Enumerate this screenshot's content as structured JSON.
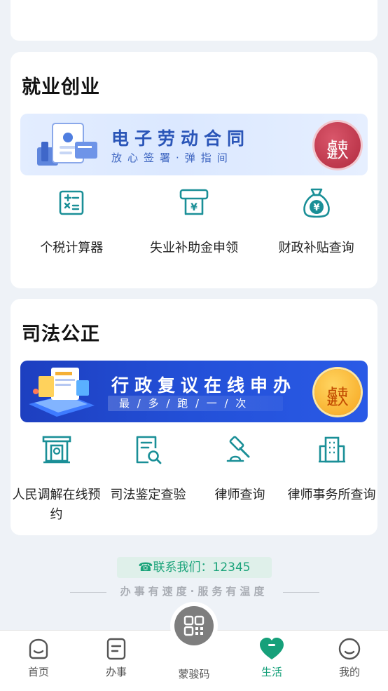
{
  "employment": {
    "title": "就业创业",
    "banner": {
      "title": "电子劳动合同",
      "subtitle": "放心签署·弹指间",
      "button": [
        "点击",
        "进入"
      ]
    },
    "items": [
      {
        "label": "个税计算器",
        "icon": "calculator-icon"
      },
      {
        "label": "失业补助金申领",
        "icon": "atm-card-icon"
      },
      {
        "label": "财政补贴查询",
        "icon": "money-bag-icon"
      }
    ]
  },
  "justice": {
    "title": "司法公正",
    "banner": {
      "title": "行政复议在线申办",
      "subtitle": "最 / 多 / 跑 / 一 / 次",
      "button": [
        "点击",
        "进入"
      ]
    },
    "items": [
      {
        "label": "人民调解在线预约",
        "icon": "mediation-hall-icon"
      },
      {
        "label": "司法鉴定查验",
        "icon": "document-search-icon"
      },
      {
        "label": "律师查询",
        "icon": "gavel-icon"
      },
      {
        "label": "律师事务所查询",
        "icon": "office-building-icon"
      }
    ]
  },
  "footer": {
    "contact": "☎联系我们：12345",
    "slogan": "办事有速度·服务有温度"
  },
  "tabbar": {
    "tabs": [
      {
        "label": "首页",
        "icon": "home-icon"
      },
      {
        "label": "办事",
        "icon": "document-icon"
      },
      {
        "label": "蒙骏码",
        "icon": "qr-code-icon"
      },
      {
        "label": "生活",
        "icon": "heart-icon",
        "active": true
      },
      {
        "label": "我的",
        "icon": "user-icon"
      }
    ]
  },
  "colors": {
    "accent": "#16a07a",
    "icon": "#1a8f97",
    "background": "#eef2f7"
  }
}
